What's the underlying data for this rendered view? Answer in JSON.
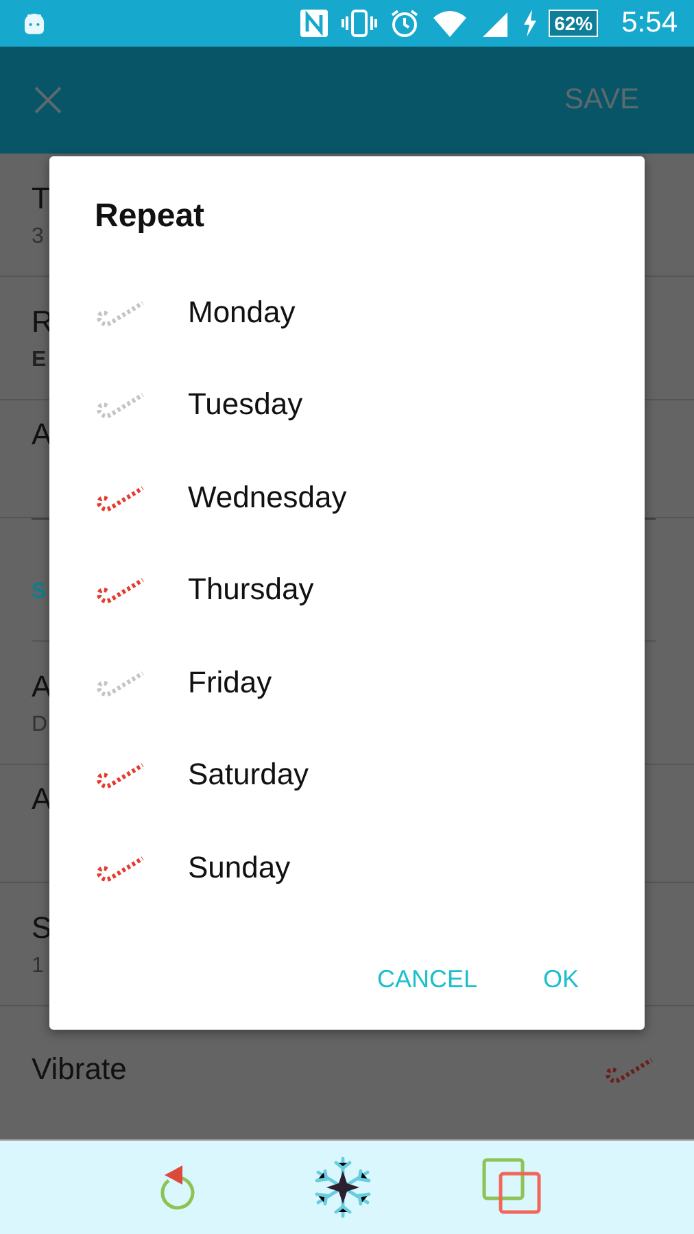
{
  "status_bar": {
    "battery": "62%",
    "time": "5:54"
  },
  "app_bar": {
    "action": "SAVE",
    "action_disabled": true
  },
  "settings": [
    {
      "kind": "two-line",
      "title": "T",
      "subtitle": "3"
    },
    {
      "kind": "two-line-bold",
      "title": "R",
      "subtitle": "E"
    },
    {
      "kind": "one-line",
      "title": "A"
    },
    {
      "kind": "header",
      "title": "S"
    },
    {
      "kind": "two-line",
      "title": "A",
      "subtitle": "D"
    },
    {
      "kind": "one-line",
      "title": "A"
    },
    {
      "kind": "two-line",
      "title": "S",
      "subtitle": "1"
    },
    {
      "kind": "switch",
      "title": "Vibrate",
      "checked": true
    }
  ],
  "dialog": {
    "title": "Repeat",
    "days": [
      {
        "label": "Monday",
        "checked": false
      },
      {
        "label": "Tuesday",
        "checked": false
      },
      {
        "label": "Wednesday",
        "checked": true
      },
      {
        "label": "Thursday",
        "checked": true
      },
      {
        "label": "Friday",
        "checked": false
      },
      {
        "label": "Saturday",
        "checked": true
      },
      {
        "label": "Sunday",
        "checked": true
      }
    ],
    "buttons": [
      "CANCEL",
      "OK"
    ]
  }
}
